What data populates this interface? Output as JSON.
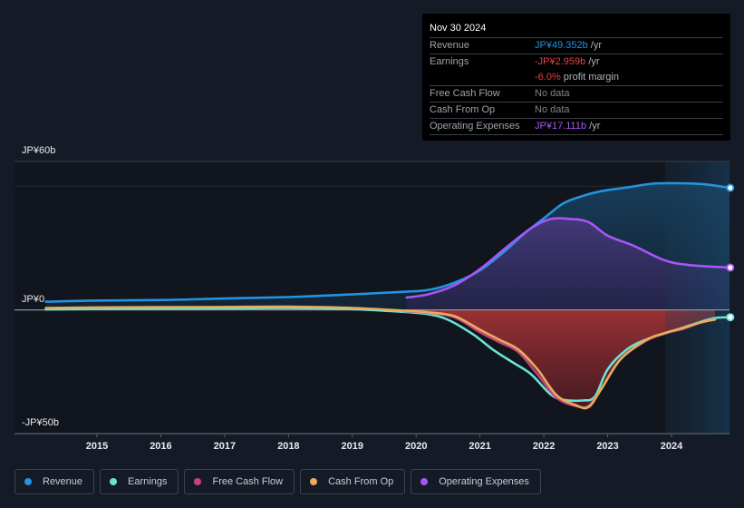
{
  "tooltip": {
    "date": "Nov 30 2024",
    "rows": [
      {
        "label": "Revenue",
        "value": "JP¥49.352b",
        "unit": " /yr",
        "color": "#2394df"
      },
      {
        "label": "Earnings",
        "value": "-JP¥2.959b",
        "unit": " /yr",
        "color": "#e64141"
      },
      {
        "label": "",
        "value": "-6.0%",
        "unit": " profit margin",
        "color": "#e64141"
      },
      {
        "label": "Free Cash Flow",
        "value": "No data",
        "unit": "",
        "color": "#7e838b"
      },
      {
        "label": "Cash From Op",
        "value": "No data",
        "unit": "",
        "color": "#7e838b"
      },
      {
        "label": "Operating Expenses",
        "value": "JP¥17.111b",
        "unit": " /yr",
        "color": "#a855f7"
      }
    ]
  },
  "legend": [
    {
      "label": "Revenue",
      "color": "#2394df"
    },
    {
      "label": "Earnings",
      "color": "#6be3d4"
    },
    {
      "label": "Free Cash Flow",
      "color": "#c4427e"
    },
    {
      "label": "Cash From Op",
      "color": "#e8ac5c"
    },
    {
      "label": "Operating Expenses",
      "color": "#a855f7"
    }
  ],
  "chart_data": {
    "type": "area",
    "title": "",
    "xlabel": "",
    "ylabel": "",
    "unit": "JP¥ billions",
    "ylim": [
      -50,
      60
    ],
    "xlim": [
      2014.2,
      2024.92
    ],
    "y_tick_labels": [
      {
        "value": 60,
        "label": "JP¥60b"
      },
      {
        "value": 0,
        "label": "JP¥0"
      },
      {
        "value": -50,
        "label": "-JP¥50b"
      }
    ],
    "x_tick_labels": [
      "2015",
      "2016",
      "2017",
      "2018",
      "2019",
      "2020",
      "2021",
      "2022",
      "2023",
      "2024"
    ],
    "x_ticks": [
      2015,
      2016,
      2017,
      2018,
      2019,
      2020,
      2021,
      2022,
      2023,
      2024
    ],
    "highlight_from": 2023.9,
    "series": [
      {
        "name": "Revenue",
        "color": "#2394df",
        "points": [
          [
            2014.2,
            3.3
          ],
          [
            2015,
            3.8
          ],
          [
            2016,
            4.0
          ],
          [
            2017,
            4.6
          ],
          [
            2018,
            5.2
          ],
          [
            2019,
            6.3
          ],
          [
            2019.8,
            7.3
          ],
          [
            2020.2,
            8.1
          ],
          [
            2020.6,
            11
          ],
          [
            2021,
            16
          ],
          [
            2021.4,
            24
          ],
          [
            2021.7,
            31
          ],
          [
            2022,
            37
          ],
          [
            2022.3,
            43
          ],
          [
            2022.6,
            46
          ],
          [
            2022.9,
            48
          ],
          [
            2023.3,
            49.5
          ],
          [
            2023.7,
            51
          ],
          [
            2024.1,
            51.2
          ],
          [
            2024.5,
            50.8
          ],
          [
            2024.92,
            49.35
          ]
        ]
      },
      {
        "name": "Operating Expenses",
        "color": "#a855f7",
        "points": [
          [
            2019.85,
            5
          ],
          [
            2020.2,
            6.4
          ],
          [
            2020.6,
            10
          ],
          [
            2021,
            16.5
          ],
          [
            2021.4,
            25
          ],
          [
            2021.8,
            33
          ],
          [
            2022.1,
            36.7
          ],
          [
            2022.4,
            36.8
          ],
          [
            2022.7,
            35.5
          ],
          [
            2023,
            30
          ],
          [
            2023.4,
            26
          ],
          [
            2023.9,
            20
          ],
          [
            2024.3,
            18.1
          ],
          [
            2024.92,
            17.11
          ]
        ]
      },
      {
        "name": "Earnings",
        "color": "#6be3d4",
        "points": [
          [
            2014.2,
            0.2
          ],
          [
            2015,
            0.4
          ],
          [
            2016,
            0.5
          ],
          [
            2017,
            0.6
          ],
          [
            2018,
            0.8
          ],
          [
            2019,
            0.3
          ],
          [
            2019.8,
            -0.8
          ],
          [
            2020.2,
            -1.8
          ],
          [
            2020.5,
            -4
          ],
          [
            2020.9,
            -10
          ],
          [
            2021.2,
            -16
          ],
          [
            2021.5,
            -21
          ],
          [
            2021.8,
            -26
          ],
          [
            2022.1,
            -34
          ],
          [
            2022.3,
            -36.3
          ],
          [
            2022.6,
            -36.6
          ],
          [
            2022.8,
            -35
          ],
          [
            2023,
            -24
          ],
          [
            2023.3,
            -16
          ],
          [
            2023.6,
            -12
          ],
          [
            2023.9,
            -9.5
          ],
          [
            2024.2,
            -7
          ],
          [
            2024.5,
            -4.5
          ],
          [
            2024.7,
            -3.2
          ],
          [
            2024.92,
            -2.96
          ]
        ]
      },
      {
        "name": "Free Cash Flow",
        "color": "#c4427e",
        "points": [
          [
            2019.8,
            -0.5
          ],
          [
            2020.2,
            -1.2
          ],
          [
            2020.6,
            -3
          ],
          [
            2021,
            -9
          ],
          [
            2021.3,
            -13
          ],
          [
            2021.6,
            -17
          ],
          [
            2021.9,
            -26
          ],
          [
            2022.2,
            -35.5
          ],
          [
            2022.5,
            -38.8
          ],
          [
            2022.7,
            -38.8
          ],
          [
            2022.9,
            -32
          ],
          [
            2023.2,
            -20
          ],
          [
            2023.6,
            -12.5
          ],
          [
            2023.9,
            -9.5
          ],
          [
            2024.2,
            -7.5
          ],
          [
            2024.45,
            -5.2
          ],
          [
            2024.68,
            -3.8
          ]
        ]
      },
      {
        "name": "Cash From Op",
        "color": "#e8ac5c",
        "points": [
          [
            2014.2,
            0.8
          ],
          [
            2015,
            1.0
          ],
          [
            2016,
            1.1
          ],
          [
            2017,
            1.2
          ],
          [
            2018,
            1.3
          ],
          [
            2019,
            0.8
          ],
          [
            2019.8,
            -0.3
          ],
          [
            2020.2,
            -1
          ],
          [
            2020.6,
            -2.5
          ],
          [
            2021,
            -8
          ],
          [
            2021.3,
            -12
          ],
          [
            2021.6,
            -16
          ],
          [
            2021.9,
            -24
          ],
          [
            2022.2,
            -34.5
          ],
          [
            2022.5,
            -38.5
          ],
          [
            2022.7,
            -39.3
          ],
          [
            2022.9,
            -32
          ],
          [
            2023.2,
            -20
          ],
          [
            2023.6,
            -12.2
          ],
          [
            2023.9,
            -9.3
          ],
          [
            2024.2,
            -7.2
          ],
          [
            2024.45,
            -5.1
          ],
          [
            2024.68,
            -3.9
          ]
        ]
      }
    ]
  }
}
